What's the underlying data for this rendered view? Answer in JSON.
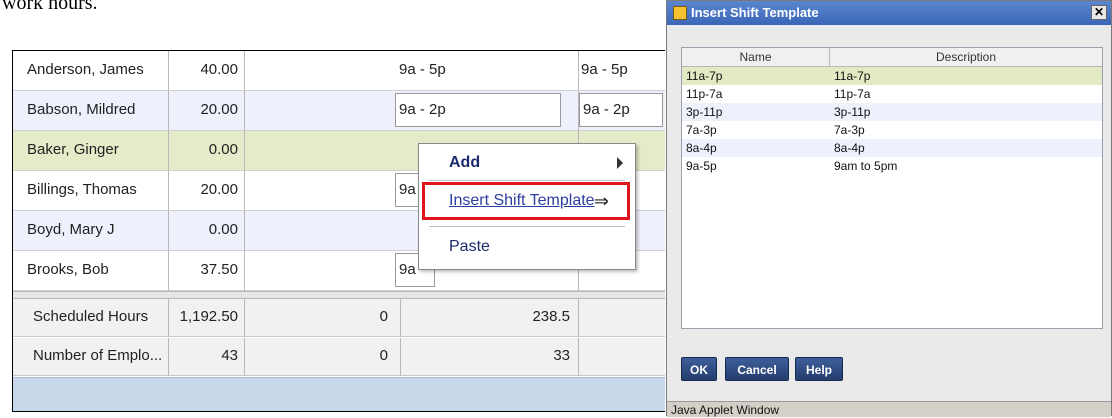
{
  "doc": {
    "text": "work hours."
  },
  "schedule": {
    "rows": [
      {
        "name": "Anderson, James",
        "hours": "40.00",
        "shift1": "9a - 5p",
        "shift2": "9a - 5p"
      },
      {
        "name": "Babson, Mildred",
        "hours": "20.00",
        "shift1": "9a - 2p",
        "shift2": "9a - 2p"
      },
      {
        "name": "Baker, Ginger",
        "hours": "0.00",
        "shift1": "",
        "shift2": ""
      },
      {
        "name": "Billings, Thomas",
        "hours": "20.00",
        "shift1": "9a",
        "shift2": ""
      },
      {
        "name": "Boyd, Mary J",
        "hours": "0.00",
        "shift1": "",
        "shift2": ""
      },
      {
        "name": "Brooks, Bob",
        "hours": "37.50",
        "shift1": "9a",
        "shift2": ""
      }
    ],
    "totals": [
      {
        "label": "Scheduled Hours",
        "hours": "1,192.50",
        "a": "0",
        "b": "238.5"
      },
      {
        "label": "Number of Emplo...",
        "hours": "43",
        "a": "0",
        "b": "33"
      }
    ]
  },
  "context_menu": {
    "add": "Add",
    "insert_template": "Insert Shift Template",
    "insert_arrow": "⇒",
    "paste": "Paste"
  },
  "dialog": {
    "title": "Insert Shift Template",
    "close": "✕",
    "columns": {
      "name": "Name",
      "description": "Description"
    },
    "templates": [
      {
        "name": "11a-7p",
        "description": "11a-7p"
      },
      {
        "name": "11p-7a",
        "description": "11p-7a"
      },
      {
        "name": "3p-11p",
        "description": "3p-11p"
      },
      {
        "name": "7a-3p",
        "description": "7a-3p"
      },
      {
        "name": "8a-4p",
        "description": "8a-4p"
      },
      {
        "name": "9a-5p",
        "description": "9am to 5pm"
      }
    ],
    "buttons": {
      "ok": "OK",
      "cancel": "Cancel",
      "help": "Help"
    },
    "status": "Java Applet Window"
  }
}
